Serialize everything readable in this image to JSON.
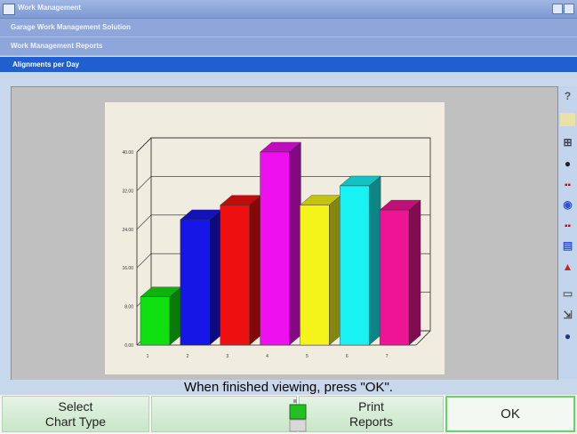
{
  "window": {
    "title": "Work Management"
  },
  "breadcrumbs": [
    "Garage Work Management Solution",
    "Work Management Reports"
  ],
  "subtitle": "Alignments per Day",
  "status_message": "When finished viewing, press \"OK\".",
  "buttons": {
    "select_chart_type": [
      "Select",
      "Chart Type"
    ],
    "print_reports": [
      "Print",
      "Reports"
    ],
    "ok": "OK"
  },
  "toolbar_icons": [
    "help-icon",
    "notepad-icon",
    "network-icon",
    "tire-icon",
    "stoplight-icon",
    "sensor-icon",
    "stoplight-icon",
    "vehicle-specs-icon",
    "tools-icon",
    "printer-icon",
    "printer-arrow-icon",
    "globe-icon"
  ],
  "chart_data": {
    "type": "bar",
    "style": "3d",
    "categories": [
      "1",
      "2",
      "3",
      "4",
      "5",
      "6",
      "7"
    ],
    "values": [
      10,
      26,
      29,
      40,
      29,
      33,
      28
    ],
    "colors": [
      "#10e010",
      "#1616e6",
      "#ee1010",
      "#ee10ee",
      "#f4f41a",
      "#18f2f2",
      "#ee1493"
    ],
    "ylim": [
      0,
      40
    ],
    "yticks": [
      "0.00",
      "8.00",
      "16.00",
      "24.00",
      "32.00",
      "40.00"
    ],
    "grid": true,
    "legend": "none"
  }
}
